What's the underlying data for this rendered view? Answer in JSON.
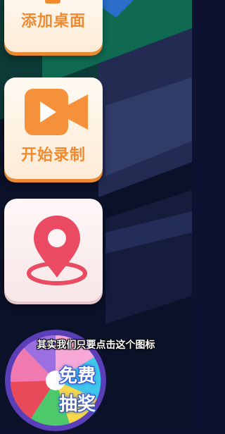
{
  "buttons": {
    "add_desktop": "添加桌面",
    "start_recording": "开始录制",
    "lottery_line1": "免费",
    "lottery_line2": "抽奖"
  },
  "subtitle": "其实我们只要点击这个图标",
  "icons": {
    "add_desktop": "add-desktop-icon",
    "record": "video-camera-icon",
    "location": "map-pin-icon",
    "lottery": "prize-wheel-icon"
  },
  "colors": {
    "accent_orange": "#f08a2c",
    "pin_red": "#ea4a62",
    "background_dark": "#0c1230",
    "background_green": "#0f5a4a"
  }
}
